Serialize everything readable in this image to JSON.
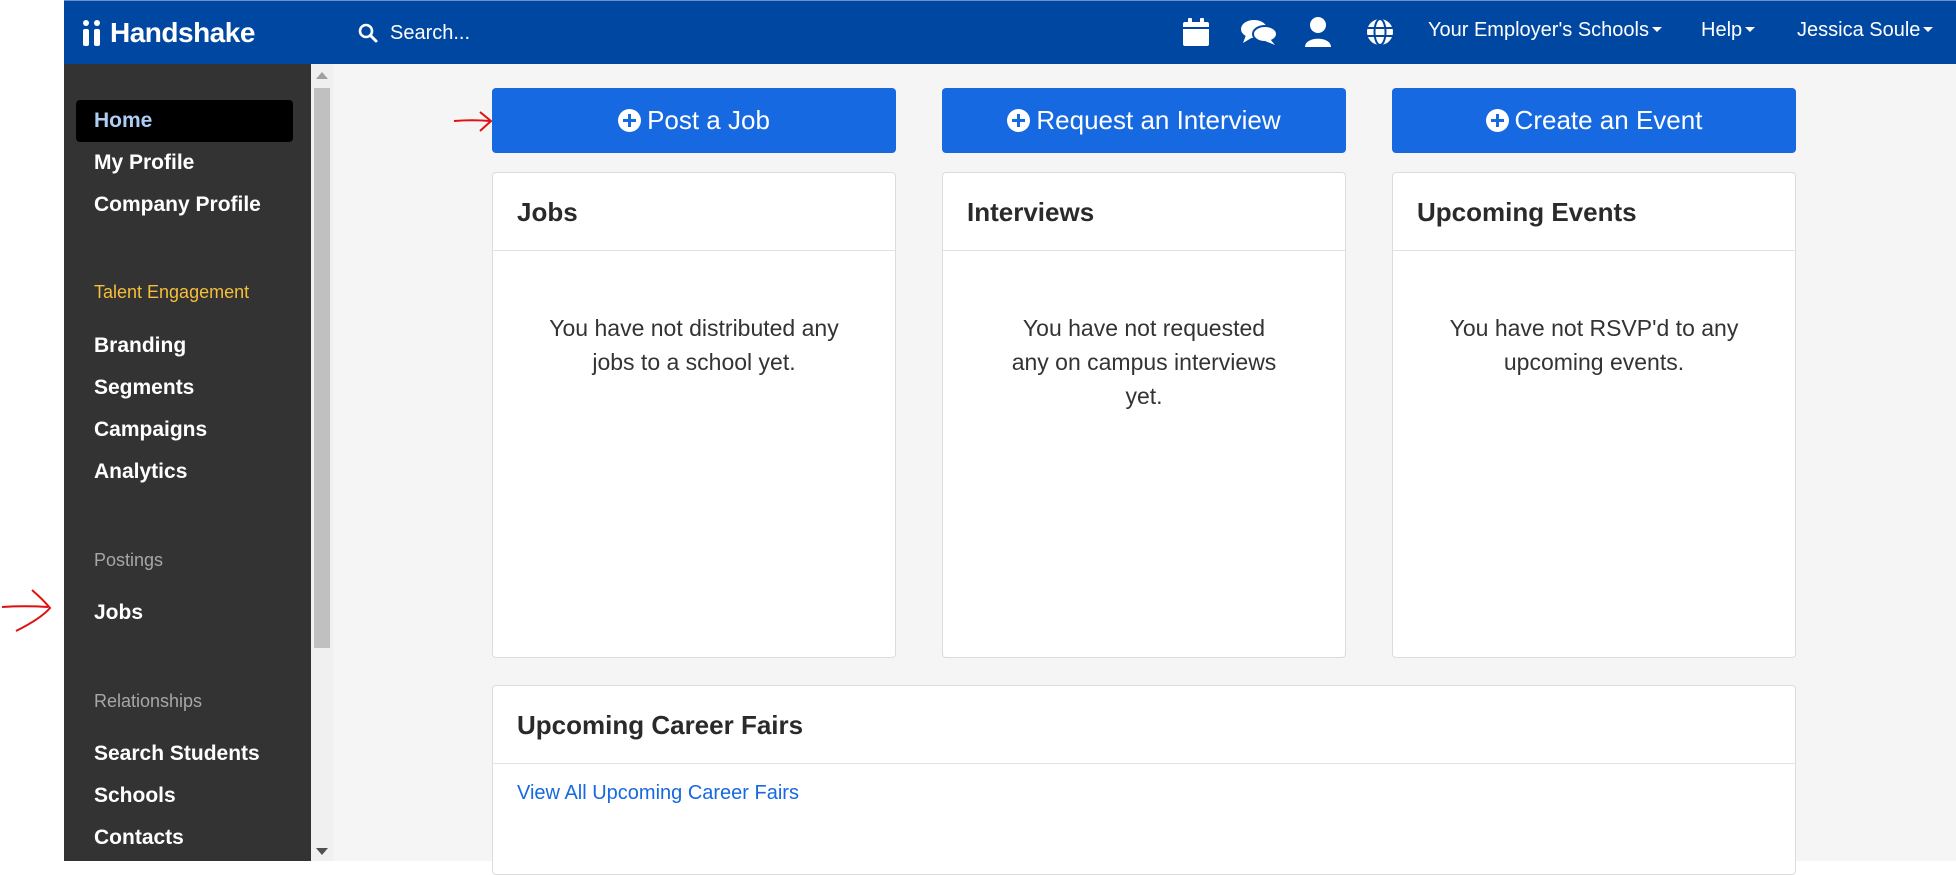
{
  "brand": {
    "name": "Handshake"
  },
  "search": {
    "placeholder": "Search..."
  },
  "topnav": {
    "icons": [
      "calendar-icon",
      "chat-icon",
      "user-icon",
      "globe-icon"
    ],
    "menus": [
      "Your Employer's Schools",
      "Help",
      "Jessica Soule"
    ]
  },
  "sidebar": {
    "items_top": [
      "Home",
      "My Profile",
      "Company Profile"
    ],
    "section_talent": "Talent Engagement",
    "items_talent": [
      "Branding",
      "Segments",
      "Campaigns",
      "Analytics"
    ],
    "section_postings": "Postings",
    "items_postings": [
      "Jobs"
    ],
    "section_relationships": "Relationships",
    "items_relationships": [
      "Search Students",
      "Schools",
      "Contacts"
    ],
    "active": "Home"
  },
  "actions": [
    "Post a Job",
    "Request an Interview",
    "Create an Event"
  ],
  "cards": [
    {
      "title": "Jobs",
      "message": "You have not distributed any jobs to a school yet."
    },
    {
      "title": "Interviews",
      "message": "You have not requested any on campus interviews yet."
    },
    {
      "title": "Upcoming Events",
      "message": "You have not RSVP'd to any upcoming events."
    }
  ],
  "career_fairs": {
    "title": "Upcoming Career Fairs",
    "link": "View All Upcoming Career Fairs"
  },
  "colors": {
    "nav": "#0047a1",
    "sidebar": "#333333",
    "primary": "#1669e0",
    "accent": "#f5bf3b",
    "annotation": "#e01010"
  }
}
